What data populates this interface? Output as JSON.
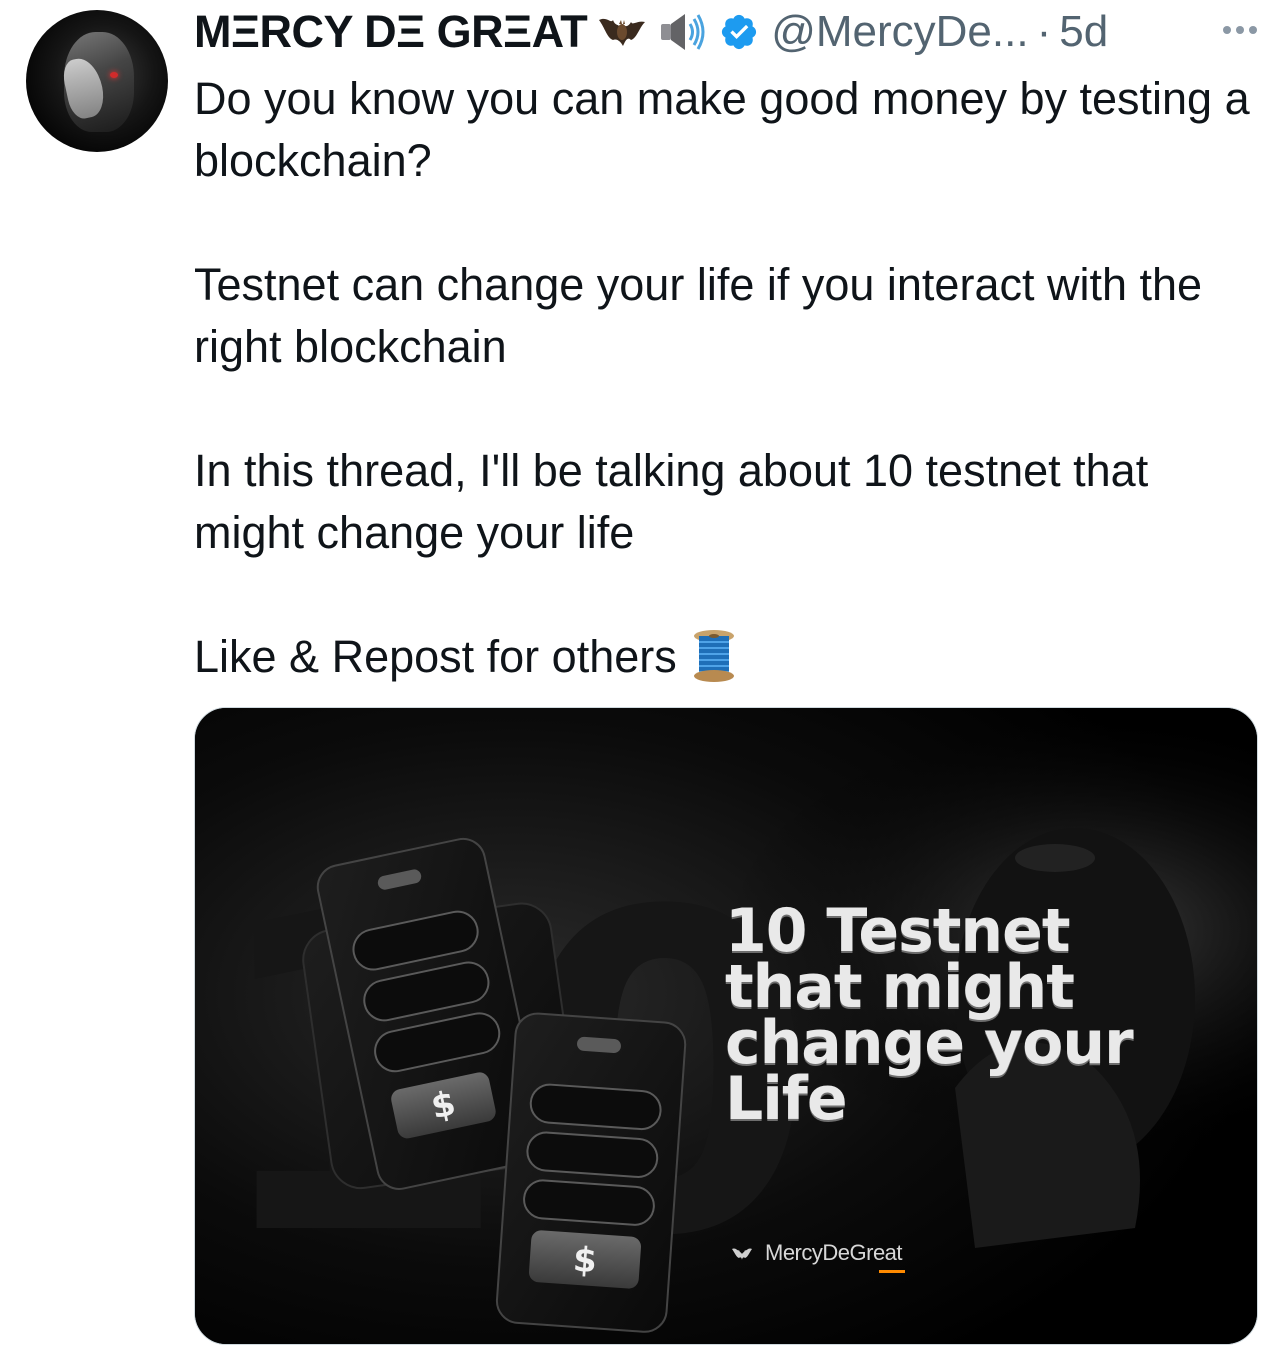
{
  "author": {
    "display_name": "MΞRCY DΞ GRΞAT",
    "emojis": [
      "bat-emoji",
      "speaker-emoji"
    ],
    "verified": true,
    "handle": "@MercyDe...",
    "separator": "·",
    "time": "5d"
  },
  "tweet": {
    "paragraphs": [
      "Do you know you can make good money by testing a blockchain?",
      "Testnet can change your life if you interact with the right blockchain",
      "In this thread, I'll be talking about 10 testnet that might change your life",
      "Like & Repost for others"
    ],
    "trailing_emoji": "spool-of-thread-emoji"
  },
  "media": {
    "headline": "10 Testnet\nthat might\nchange your\nLife",
    "credit": "MercyDeGreat",
    "price_symbol": "$"
  },
  "colors": {
    "text_primary": "#0f1419",
    "text_secondary": "#536471",
    "verified_blue": "#1d9bf0",
    "accent_orange": "#ff8a00"
  }
}
